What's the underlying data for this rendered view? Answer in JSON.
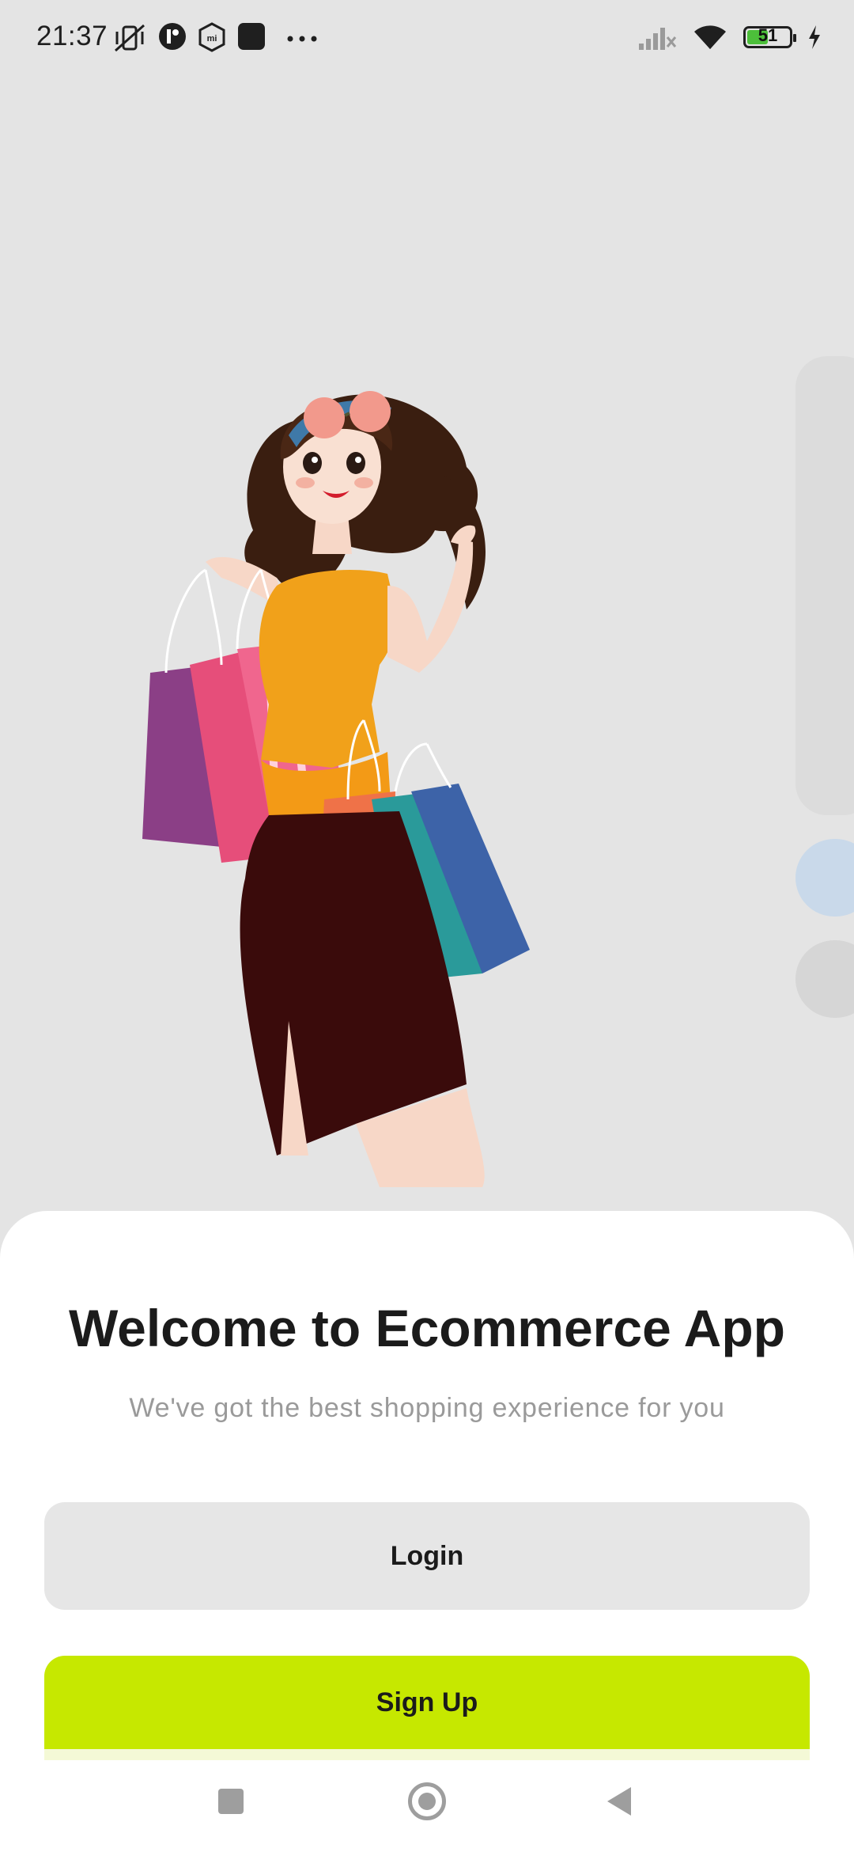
{
  "status_bar": {
    "time": "21:37",
    "battery_level": "51",
    "icons": [
      "mute-vibrate-icon",
      "app-notification-icon",
      "mi-icon",
      "square-app-icon",
      "more-dots-icon",
      "signal-icon",
      "wifi-icon",
      "battery-icon",
      "charging-icon"
    ]
  },
  "welcome": {
    "title": "Welcome to Ecommerce App",
    "subtitle": "We've got the best shopping experience for you"
  },
  "buttons": {
    "login": "Login",
    "signup": "Sign Up"
  },
  "colors": {
    "accent": "#c6e800",
    "secondary_button": "#e6e6e6",
    "background": "#e4e4e4"
  },
  "nav_bar": {
    "icons": [
      "recent-apps-icon",
      "home-icon",
      "back-icon"
    ]
  }
}
